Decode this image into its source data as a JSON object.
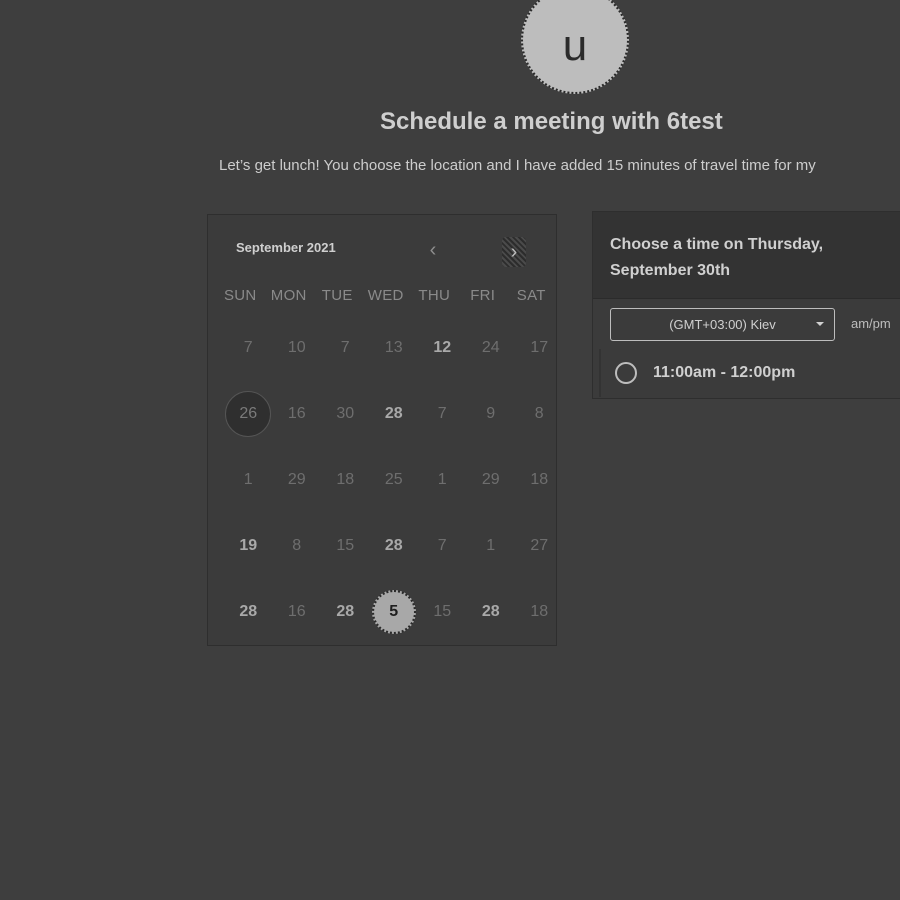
{
  "avatar": {
    "initial": "u"
  },
  "header": {
    "title": "Schedule a meeting with 6test",
    "subtitle": "Let’s get lunch! You choose the location and I have added 15 minutes of travel time for my"
  },
  "calendar": {
    "month_label": "September 2021",
    "prev_icon": "chevron-left-icon",
    "next_icon": "chevron-right-icon",
    "weekdays": [
      "SUN",
      "MON",
      "TUE",
      "WED",
      "THU",
      "FRI",
      "SAT"
    ],
    "weeks": [
      [
        "7",
        "10",
        "7",
        "13",
        "12",
        "24",
        "17"
      ],
      [
        "26",
        "16",
        "30",
        "28",
        "7",
        "9",
        "8"
      ],
      [
        "1",
        "29",
        "18",
        "25",
        "1",
        "29",
        "18"
      ],
      [
        "19",
        "8",
        "15",
        "28",
        "7",
        "1",
        "27"
      ],
      [
        "28",
        "16",
        "28",
        "5",
        "15",
        "28",
        "18"
      ]
    ]
  },
  "time_panel": {
    "heading": "Choose a time on Thursday, September 30th",
    "timezone": "(GMT+03:00) Kiev",
    "format_toggle": "am/pm",
    "slots": [
      "11:00am - 12:00pm"
    ]
  }
}
